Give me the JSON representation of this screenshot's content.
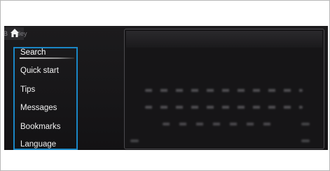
{
  "header": {
    "home_caption_left": "B",
    "home_caption_right": "lley"
  },
  "menu": {
    "items": [
      {
        "label": "Search",
        "selected": true
      },
      {
        "label": "Quick start",
        "selected": false
      },
      {
        "label": "Tips",
        "selected": false
      },
      {
        "label": "Messages",
        "selected": false
      },
      {
        "label": "Bookmarks",
        "selected": false
      },
      {
        "label": "Language",
        "selected": false
      }
    ],
    "highlight_color": "#1a86c5"
  },
  "icons": {
    "home": "home-icon"
  }
}
